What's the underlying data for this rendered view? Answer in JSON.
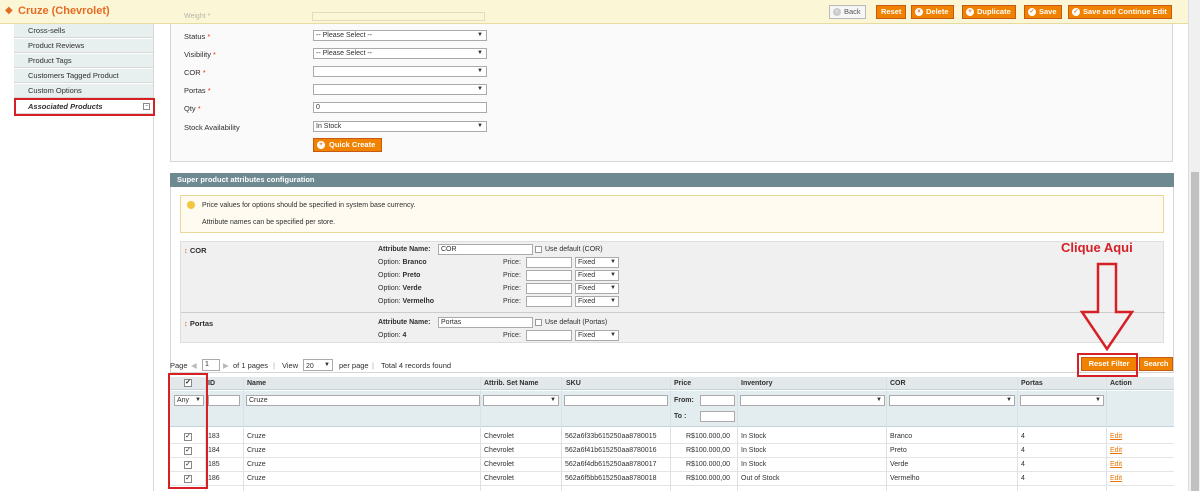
{
  "header": {
    "title": "Cruze (Chevrolet)",
    "ghost_label": "Weight *",
    "buttons": {
      "back": "Back",
      "reset": "Reset",
      "delete": "Delete",
      "duplicate": "Duplicate",
      "save": "Save",
      "save_continue": "Save and Continue Edit"
    }
  },
  "sidebar": {
    "items": [
      {
        "label": "Cross-sells"
      },
      {
        "label": "Product Reviews"
      },
      {
        "label": "Product Tags"
      },
      {
        "label": "Customers Tagged Product"
      },
      {
        "label": "Custom Options"
      },
      {
        "label": "Associated Products",
        "active": true
      }
    ]
  },
  "quick_form": {
    "status": {
      "label": "Status",
      "value": "-- Please Select --"
    },
    "visibility": {
      "label": "Visibility",
      "value": "-- Please Select --"
    },
    "cor": {
      "label": "COR",
      "value": ""
    },
    "portas": {
      "label": "Portas",
      "value": ""
    },
    "qty": {
      "label": "Qty",
      "value": "0"
    },
    "stock": {
      "label": "Stock Availability",
      "value": "In Stock"
    },
    "quick_create": "Quick Create"
  },
  "super_attrs": {
    "title": "Super product attributes configuration",
    "notice_1": "Price values for options should be specified in system base currency.",
    "notice_2": "Attribute names can be specified per store.",
    "attributes": [
      {
        "code": "COR",
        "name_label": "Attribute Name:",
        "name_value": "COR",
        "use_default": "Use default (COR)",
        "options": [
          {
            "label": "Option:",
            "name": "Branco",
            "price_label": "Price:",
            "type": "Fixed"
          },
          {
            "label": "Option:",
            "name": "Preto",
            "price_label": "Price:",
            "type": "Fixed"
          },
          {
            "label": "Option:",
            "name": "Verde",
            "price_label": "Price:",
            "type": "Fixed"
          },
          {
            "label": "Option:",
            "name": "Vermelho",
            "price_label": "Price:",
            "type": "Fixed"
          }
        ]
      },
      {
        "code": "Portas",
        "name_label": "Attribute Name:",
        "name_value": "Portas",
        "use_default": "Use default (Portas)",
        "options": [
          {
            "label": "Option:",
            "name": "4",
            "price_label": "Price:",
            "type": "Fixed"
          }
        ]
      }
    ]
  },
  "annotation": {
    "text": "Clique Aqui",
    "color": "#d52026"
  },
  "pager": {
    "page_label": "Page",
    "page_value": "1",
    "of_pages": "of 1 pages",
    "view_label": "View",
    "per_page_value": "20",
    "per_page_label": "per page",
    "total": "Total 4 records found",
    "reset_filter": "Reset Filter",
    "search": "Search"
  },
  "grid": {
    "columns": [
      "ID",
      "Name",
      "Attrib. Set Name",
      "SKU",
      "Price",
      "Inventory",
      "COR",
      "Portas",
      "Action"
    ],
    "filter": {
      "any": "Any",
      "name": "Cruze",
      "from_label": "From:",
      "to_label": "To :"
    },
    "rows": [
      {
        "id": "183",
        "name": "Cruze",
        "set": "Chevrolet",
        "sku": "562a6f33b615250aa8780015",
        "price": "R$100.000,00",
        "inventory": "In Stock",
        "cor": "Branco",
        "portas": "4",
        "action": "Edit"
      },
      {
        "id": "184",
        "name": "Cruze",
        "set": "Chevrolet",
        "sku": "562a6f41b615250aa8780016",
        "price": "R$100.000,00",
        "inventory": "In Stock",
        "cor": "Preto",
        "portas": "4",
        "action": "Edit"
      },
      {
        "id": "185",
        "name": "Cruze",
        "set": "Chevrolet",
        "sku": "562a6f4db615250aa8780017",
        "price": "R$100.000,00",
        "inventory": "In Stock",
        "cor": "Verde",
        "portas": "4",
        "action": "Edit"
      },
      {
        "id": "186",
        "name": "Cruze",
        "set": "Chevrolet",
        "sku": "562a6f5bb615250aa8780018",
        "price": "R$100.000,00",
        "inventory": "Out of Stock",
        "cor": "Vermelho",
        "portas": "4",
        "action": "Edit"
      }
    ]
  }
}
